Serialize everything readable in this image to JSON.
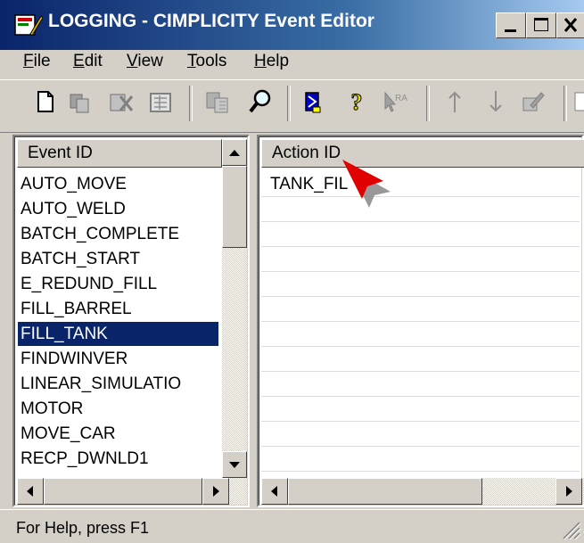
{
  "window": {
    "title": "LOGGING - CIMPLICITY Event Editor",
    "controls": [
      "minimize",
      "maximize",
      "close"
    ]
  },
  "menu": [
    {
      "label": "File",
      "mnemonic": "F",
      "rest": "ile"
    },
    {
      "label": "Edit",
      "mnemonic": "E",
      "rest": "dit"
    },
    {
      "label": "View",
      "mnemonic": "V",
      "rest": "iew"
    },
    {
      "label": "Tools",
      "mnemonic": "T",
      "rest": "ools"
    },
    {
      "label": "Help",
      "mnemonic": "H",
      "rest": "elp"
    }
  ],
  "toolbar": {
    "icons": [
      "new-icon",
      "copy-icon",
      "delete-icon",
      "properties-icon",
      "duplicate-icon",
      "find-icon",
      "point-icon",
      "help-icon",
      "help-pointer-icon",
      "move-up-icon",
      "move-down-icon",
      "edit-icon"
    ]
  },
  "events_pane": {
    "header": "Event ID",
    "items": [
      "AUTO_MOVE",
      "AUTO_WELD",
      "BATCH_COMPLETE",
      "BATCH_START",
      "E_REDUND_FILL",
      "FILL_BARREL",
      "FILL_TANK",
      "FINDWINVER",
      "LINEAR_SIMULATIO",
      "MOTOR",
      "MOVE_CAR",
      "RECP_DWNLD1"
    ],
    "selected": "FILL_TANK"
  },
  "actions_pane": {
    "header": "Action ID",
    "items": [
      "TANK_FIL"
    ]
  },
  "status": {
    "text": "For Help, press F1"
  },
  "colors": {
    "titlebar_start": "#0a246a",
    "titlebar_end": "#a6caf0",
    "selection": "#0a246a",
    "face": "#d4d0c8"
  }
}
